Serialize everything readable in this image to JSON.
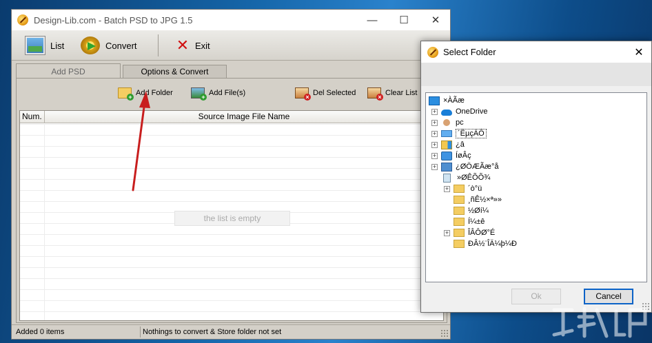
{
  "main_window": {
    "title": "Design-Lib.com - Batch PSD to JPG 1.5",
    "controls": {
      "minimize": "—",
      "maximize": "☐",
      "close": "✕"
    },
    "toolbar": {
      "list_label": "List",
      "convert_label": "Convert",
      "exit_label": "Exit"
    },
    "tabs": [
      {
        "label": "Add PSD",
        "active": true
      },
      {
        "label": "Options & Convert",
        "active": false
      }
    ],
    "actions": {
      "add_folder": "Add Folder",
      "add_files": "Add File(s)",
      "del_selected": "Del Selected",
      "clear_list": "Clear List"
    },
    "table": {
      "columns": [
        "Num.",
        "Source Image File Name"
      ],
      "rows": [],
      "empty_text": "the list is empty"
    },
    "status": {
      "left": "Added 0 items",
      "right": "Nothings to convert & Store folder not set"
    }
  },
  "dialog": {
    "title": "Select Folder",
    "close": "✕",
    "tree": [
      {
        "label": "×ÀÃæ",
        "icon": "desktop-icon",
        "expander": false
      },
      {
        "label": "OneDrive",
        "icon": "cloud-icon",
        "expander": true
      },
      {
        "label": "pc",
        "icon": "user-icon",
        "expander": true
      },
      {
        "label": "´ËµçÄÔ",
        "icon": "computer-icon",
        "expander": true,
        "selected": true
      },
      {
        "label": "¿â",
        "icon": "library-icon",
        "expander": true
      },
      {
        "label": "ÍøÂç",
        "icon": "network-icon",
        "expander": true
      },
      {
        "label": "¿ØÖÆÃæ°å",
        "icon": "control-panel-icon",
        "expander": true
      },
      {
        "label": "»ØÊÕÕ¾",
        "icon": "recycle-bin-icon",
        "expander": false
      },
      {
        "label": "´ò°ü",
        "icon": "folder-icon",
        "expander": true
      },
      {
        "label": "¸ñÊ½×ª»»",
        "icon": "folder-icon",
        "expander": false
      },
      {
        "label": "½Øí¼",
        "icon": "folder-icon",
        "expander": false
      },
      {
        "label": "Í¼±ê",
        "icon": "folder-icon",
        "expander": false
      },
      {
        "label": "ÎÂÔØ°É",
        "icon": "folder-icon",
        "expander": true
      },
      {
        "label": "ÐÂ½¨ÎÄ¼þ¼Ð",
        "icon": "folder-icon",
        "expander": false
      }
    ],
    "ok_label": "Ok",
    "cancel_label": "Cancel"
  }
}
